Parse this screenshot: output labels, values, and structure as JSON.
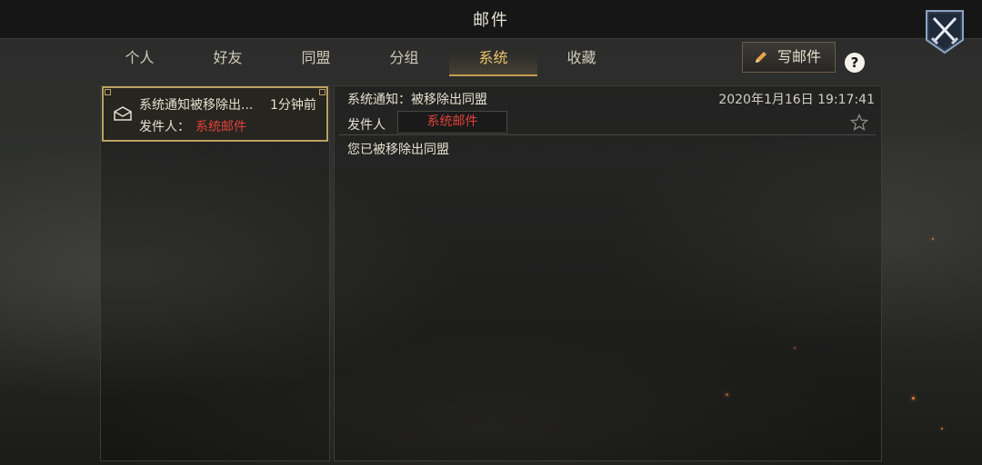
{
  "header": {
    "title": "邮件"
  },
  "tabs": [
    {
      "label": "个人"
    },
    {
      "label": "好友"
    },
    {
      "label": "同盟"
    },
    {
      "label": "分组"
    },
    {
      "label": "系统"
    },
    {
      "label": "收藏"
    }
  ],
  "active_tab": "系统",
  "toolbar": {
    "compose_label": "写邮件",
    "help_label": "?"
  },
  "mail_list": [
    {
      "subject": "系统通知被移除出...",
      "time": "1分钟前",
      "sender_label": "发件人：",
      "sender": "系统邮件",
      "icon": "envelope-icon"
    }
  ],
  "detail": {
    "subject": "系统通知：被移除出同盟",
    "date": "2020年1月16日 19:17:41",
    "sender_label": "发件人",
    "sender": "系统邮件",
    "body": "您已被移除出同盟"
  },
  "colors": {
    "accent_gold": "#f0c46a",
    "sender_red": "#e0413a",
    "border_gold": "#b9a263"
  }
}
